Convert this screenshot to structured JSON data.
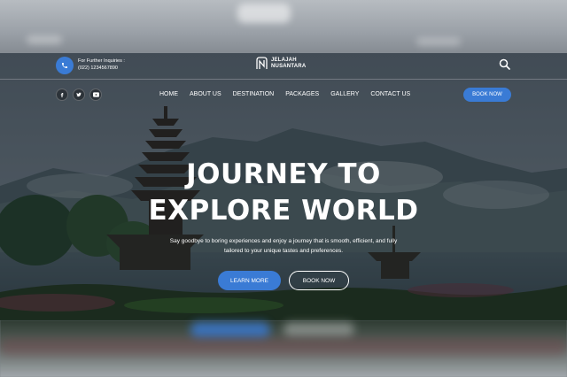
{
  "header": {
    "inquiry_label": "For Further Inquiries :",
    "phone": "(022) 1234567890",
    "logo_line1": "JELAJAH",
    "logo_line2": "NUSANTARA"
  },
  "social": [
    "facebook-icon",
    "twitter-icon",
    "youtube-icon"
  ],
  "nav": {
    "items": [
      "HOME",
      "ABOUT US",
      "DESTINATION",
      "PACKAGES",
      "GALLERY",
      "CONTACT US"
    ],
    "book_label": "BOOK NOW"
  },
  "hero": {
    "title_line1": "JOURNEY TO",
    "title_line2": "EXPLORE WORLD",
    "subtitle_line1": "Say goodbye to boring experiences and enjoy a journey that is smooth, efficient, and fully",
    "subtitle_line2": "tailored to your unique tastes and preferences.",
    "learn_more": "LEARN MORE",
    "book_now": "BOOK NOW"
  },
  "colors": {
    "accent": "#3a7bd5",
    "text": "#ffffff"
  }
}
